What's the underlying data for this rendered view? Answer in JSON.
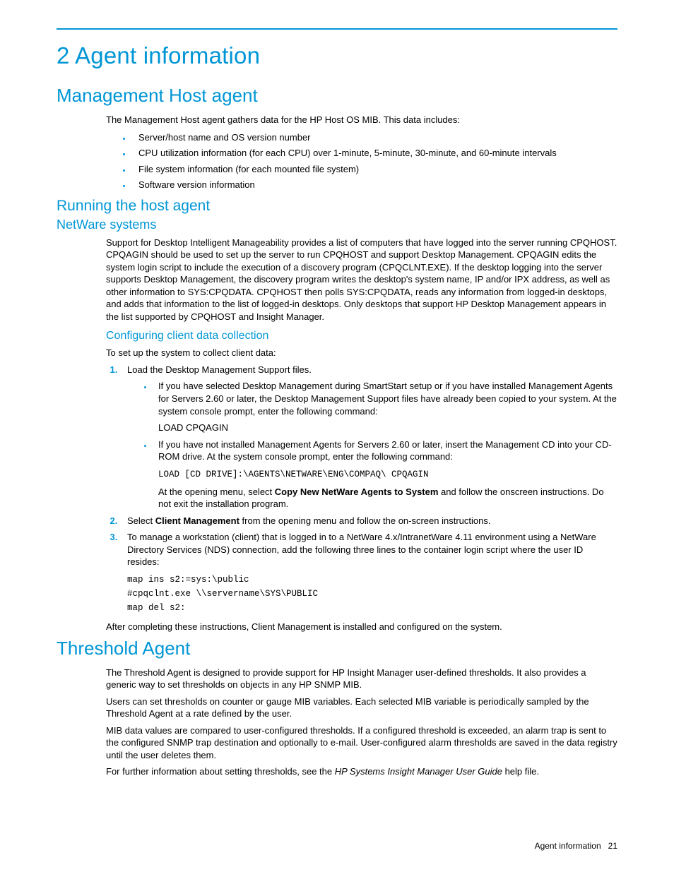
{
  "chapter_title": "2 Agent information",
  "s1": {
    "title": "Management Host agent",
    "intro": "The Management Host agent gathers data for the HP Host OS MIB. This data includes:",
    "bullets": [
      "Server/host name and OS version number",
      "CPU utilization information (for each CPU) over 1-minute, 5-minute, 30-minute, and 60-minute intervals",
      "File system information (for each mounted file system)",
      "Software version information"
    ],
    "sub1": {
      "title": "Running the host agent",
      "netware": {
        "title": "NetWare systems",
        "para": "Support for Desktop Intelligent Manageability provides a list of computers that have logged into the server running CPQHOST. CPQAGIN should be used to set up the server to run CPQHOST and support Desktop Management. CPQAGIN edits the system login script to include the execution of a discovery program (CPQCLNT.EXE). If the desktop logging into the server supports Desktop Management, the discovery program writes the desktop's system name, IP and/or IPX address, as well as other information to SYS:CPQDATA. CPQHOST then polls SYS:CPQDATA, reads any information from logged-in desktops, and adds that information to the list of logged-in desktops. Only desktops that support HP Desktop Management appears in the list supported by CPQHOST and Insight Manager.",
        "config": {
          "title": "Configuring client data collection",
          "intro": "To set up the system to collect client data:",
          "step1": "Load the Desktop Management Support files.",
          "step1_b1": "If you have selected Desktop Management during SmartStart setup or if you have installed Management Agents for Servers 2.60 or later, the Desktop Management Support files have already been copied to your system. At the system console prompt, enter the following command:",
          "step1_b1_cmd": "LOAD CPQAGIN",
          "step1_b2": "If you have not installed Management Agents for Servers 2.60 or later, insert the Management CD into your CD-ROM drive. At the system console prompt, enter the following command:",
          "step1_b2_cmd": "LOAD [CD DRIVE]:\\AGENTS\\NETWARE\\ENG\\COMPAQ\\ CPQAGIN",
          "step1_b2_after_a": "At the opening menu, select ",
          "step1_b2_bold": "Copy New NetWare Agents to System",
          "step1_b2_after_b": " and follow the onscreen instructions. Do not exit the installation program.",
          "step2_a": "Select ",
          "step2_bold": "Client Management",
          "step2_b": " from the opening menu and follow the on-screen instructions.",
          "step3": "To manage a workstation (client) that is logged in to a NetWare 4.x/IntranetWare 4.11 environment using a NetWare Directory Services (NDS) connection, add the following three lines to the container login script where the user ID resides:",
          "step3_cmd": "map ins s2:=sys:\\public\n#cpqclnt.exe \\\\servername\\SYS\\PUBLIC\nmap del s2:",
          "outro": "After completing these instructions, Client Management is installed and configured on the system."
        }
      }
    }
  },
  "s2": {
    "title": "Threshold Agent",
    "p1": "The Threshold Agent is designed to provide support for HP Insight Manager user-defined thresholds. It also provides a generic way to set thresholds on objects in any HP SNMP MIB.",
    "p2": "Users can set thresholds on counter or gauge MIB variables. Each selected MIB variable is periodically sampled by the Threshold Agent at a rate defined by the user.",
    "p3": "MIB data values are compared to user-configured thresholds. If a configured threshold is exceeded, an alarm trap is sent to the configured SNMP trap destination and optionally to e-mail. User-configured alarm thresholds are saved in the data registry until the user deletes them.",
    "p4_a": "For further information about setting thresholds, see the ",
    "p4_i": "HP Systems Insight Manager User Guide",
    "p4_b": " help file."
  },
  "footer": {
    "section": "Agent information",
    "page": "21"
  }
}
